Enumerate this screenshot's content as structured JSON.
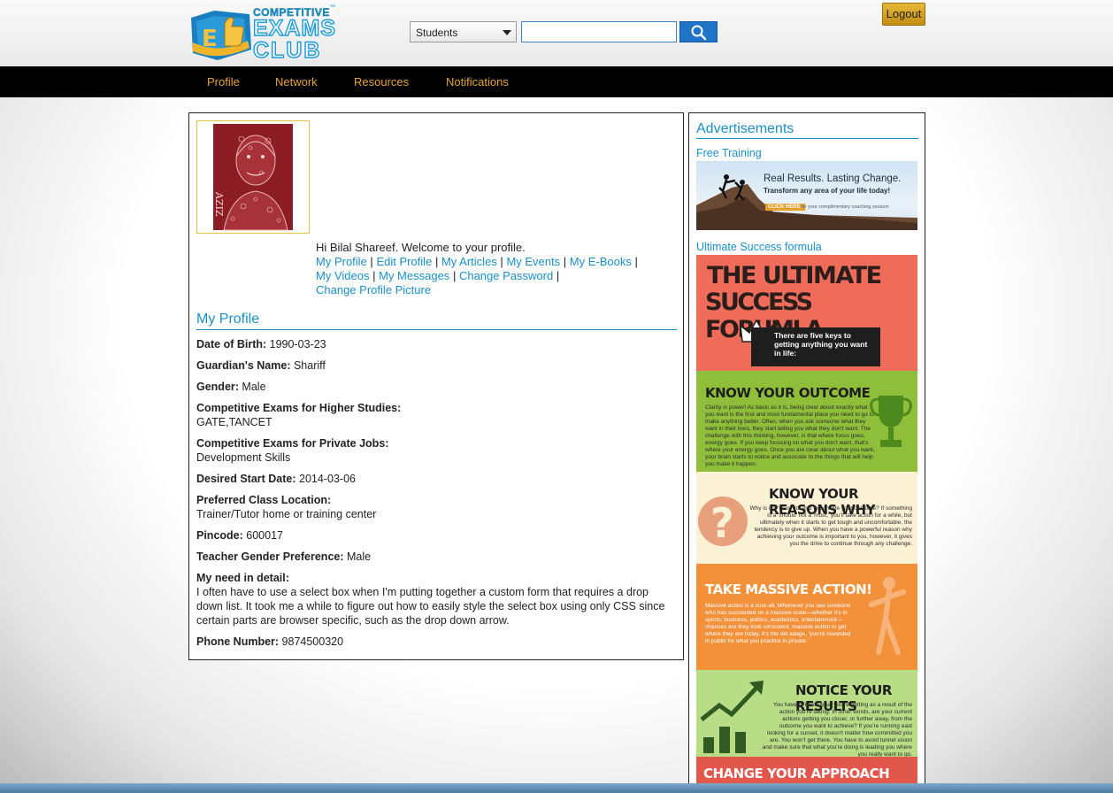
{
  "logo": {
    "badge_letter": "E",
    "line1": "COMPETITIVE",
    "line2": "EXAMS",
    "line3": "CLUB",
    "tm": "™"
  },
  "search": {
    "category": "Students",
    "placeholder": "",
    "value": ""
  },
  "header": {
    "logout_label": "Logout"
  },
  "nav": {
    "items": [
      "Profile",
      "Network",
      "Resources",
      "Notifications"
    ]
  },
  "profile": {
    "welcome": "Hi Bilal Shareef. Welcome to your profile.",
    "links": [
      "My Profile",
      "Edit Profile",
      "My Articles",
      "My Events",
      "My E-Books",
      "My Videos",
      "My Messages",
      "Change Password",
      "Change Profile Picture"
    ],
    "separator": "|",
    "section_title": "My Profile",
    "fields": [
      {
        "label": "Date of Birth:",
        "value": "1990-03-23",
        "block": false
      },
      {
        "label": "Guardian's Name:",
        "value": "Shariff",
        "block": false
      },
      {
        "label": "Gender:",
        "value": "Male",
        "block": false
      },
      {
        "label": "Competitive Exams for Higher Studies:",
        "value": "GATE,TANCET",
        "block": true
      },
      {
        "label": "Competitive Exams for Private Jobs:",
        "value": "Development Skills",
        "block": true
      },
      {
        "label": "Desired Start Date:",
        "value": "2014-03-06",
        "block": false
      },
      {
        "label": "Preferred Class Location:",
        "value": "Trainer/Tutor home or training center",
        "block": true
      },
      {
        "label": "Pincode:",
        "value": "600017",
        "block": false
      },
      {
        "label": "Teacher Gender Preference:",
        "value": "Male",
        "block": false
      },
      {
        "label": "My need in detail:",
        "value": "I often have to use a select box when I'm putting together a custom form that requires a drop down list. It took me a while to figure out how to easily style the select box using only CSS since certain parts are browser specific, such as the drop down arrow.",
        "block": true
      },
      {
        "label": "Phone Number:",
        "value": "9874500320",
        "block": false
      }
    ]
  },
  "sidebar": {
    "title": "Advertisements",
    "ad1": {
      "label": "Free Training",
      "headline": "Real Results. Lasting Change.",
      "subline": "Transform any area of your life today!",
      "button": "CLICK HERE!",
      "note": "for your complimentary coaching session"
    },
    "ad2": {
      "label": "Ultimate Success formula",
      "title_line1": "THE ULTIMATE",
      "title_line2": "SUCCESS FORUMLA",
      "callout": "There are five keys to getting anything you want in life:",
      "sections": [
        {
          "title": "KNOW YOUR OUTCOME",
          "text": "Clarity is power! As basic as it is, being clear about exactly what you want is the first and most fundamental place you need to go to make anything better. Often, when you ask someone what they want in their lives, they start telling you what they don't want. The challenge with this thinking, however, is that where focus goes, energy goes. If you keep focusing on what you don't want, that's where your energy goes. Once you are clear about what you want, your brain starts to notice and associate to the things that will help you make it happen."
        },
        {
          "title": "KNOW YOUR REASONS WHY",
          "text": "Why is it a 'must' for you to achieve your outcome? If something is a 'should' not a 'must,' you'll take action for a while, but ultimately when it starts to get tough and uncomfortable, the tendency is to give up. When you have a powerful reason why achieving your outcome is important to you, however, it gives you the drive to continue through any challenge."
        },
        {
          "title": "TAKE MASSIVE ACTION!",
          "text": "Massive action is a cure-all. Whenever you see someone who has succeeded on a massive scale—whether it's in sports, business, politics, academics, entertainment—chances are they took consistent, massive action to get where they are today. It's the old adage, 'you're rewarded in public for what you practice in private.'"
        },
        {
          "title": "NOTICE YOUR RESULTS",
          "text": "You have to know what you're getting as a result of the action you're taking. In other words, are your current actions getting you closer, or further away, from the outcome you want to achieve? If you're running east looking for a sunset, it doesn't matter how committed you are. You won't get there. You have to avoid tunnel vision and make sure that what you're doing is leading you where you really want to go."
        },
        {
          "title": "CHANGE YOUR APPROACH",
          "text": ""
        }
      ]
    }
  },
  "colors": {
    "link": "#1a8fc8",
    "nav_bg": "#000000",
    "nav_text": "#e9a53a",
    "logout_bg": "#d6a426",
    "search_btn": "#1f74c7",
    "ad_red": "#ef6b5a",
    "ad_green": "#8fbf3a",
    "ad_cream": "#fbf2d6",
    "ad_orange": "#f3913b",
    "ad_lightgreen": "#b9dc86"
  }
}
